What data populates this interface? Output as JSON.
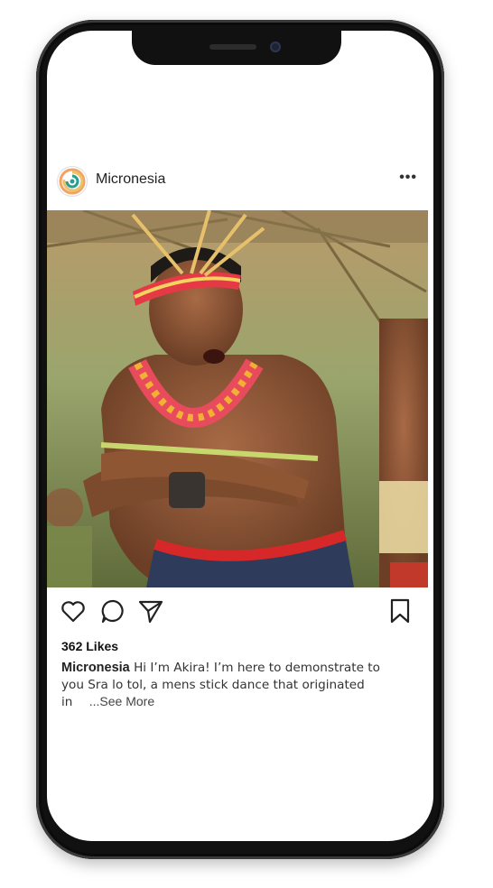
{
  "post": {
    "username": "Micronesia",
    "more_icon": "more-horizontal-icon",
    "likes": "362 Likes",
    "caption_user": "Micronesia",
    "caption_line1": "Hi I’m Akira! I’m here to demonstrate to",
    "caption_line2": "you Sra lo tol, a mens stick dance that originated",
    "caption_line3": "in",
    "see_more": "...See More"
  },
  "actions": {
    "like_icon": "heart-icon",
    "comment_icon": "comment-icon",
    "share_icon": "send-icon",
    "save_icon": "bookmark-icon"
  },
  "colors": {
    "phone_frame": "#111111",
    "avatar_swirl": [
      "#2a9d8f",
      "#e9c46a",
      "#f4a261"
    ]
  }
}
